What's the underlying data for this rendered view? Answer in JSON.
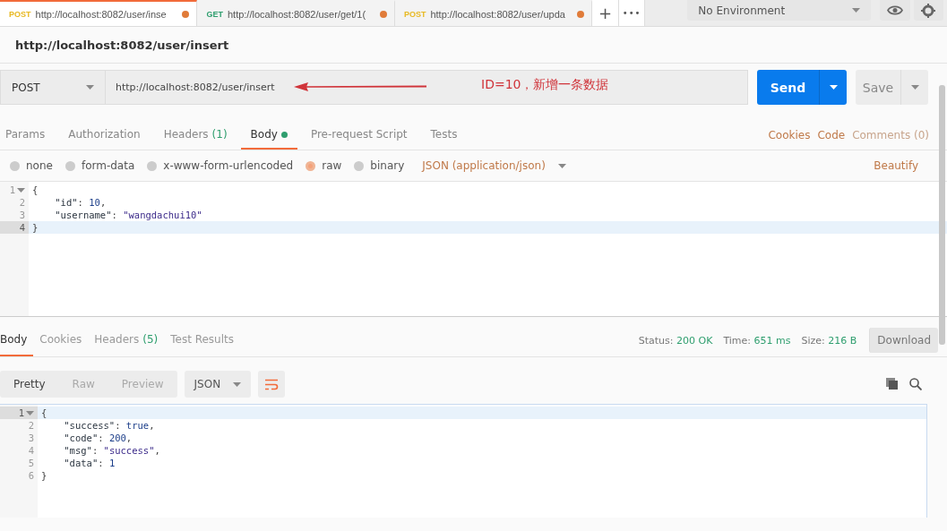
{
  "request_tabs": [
    {
      "method": "POST",
      "color": "#e8b923",
      "url": "http://localhost:8082/user/inse",
      "unsaved": true,
      "selected": true
    },
    {
      "method": "GET",
      "color": "#2e9e6e",
      "url": "http://localhost:8082/user/get/1(",
      "unsaved": true,
      "selected": false
    },
    {
      "method": "POST",
      "color": "#e8b923",
      "url": "http://localhost:8082/user/upda",
      "unsaved": true,
      "selected": false
    }
  ],
  "add_tab": "+",
  "more_tabs": "•••",
  "environment": {
    "value": "No Environment"
  },
  "request_title": "http://localhost:8082/user/insert",
  "request": {
    "method": "POST",
    "url": "http://localhost:8082/user/insert",
    "annotation": "ID=10，新增一条数据",
    "send": "Send",
    "save": "Save"
  },
  "request_sections": [
    {
      "label": "Params",
      "selected": false
    },
    {
      "label": "Authorization",
      "selected": false
    },
    {
      "label": "Headers",
      "count": "(1)",
      "selected": false
    },
    {
      "label": "Body",
      "selected": true,
      "has_content": true
    },
    {
      "label": "Pre-request Script",
      "selected": false
    },
    {
      "label": "Tests",
      "selected": false
    }
  ],
  "request_links": [
    {
      "label": "Cookies",
      "disabled": false
    },
    {
      "label": "Code",
      "disabled": false
    },
    {
      "label": "Comments (0)",
      "disabled": true
    }
  ],
  "body_types": [
    {
      "label": "none",
      "selected": false
    },
    {
      "label": "form-data",
      "selected": false
    },
    {
      "label": "x-www-form-urlencoded",
      "selected": false
    },
    {
      "label": "raw",
      "selected": true
    },
    {
      "label": "binary",
      "selected": false
    }
  ],
  "content_type": "JSON (application/json)",
  "beautify": "Beautify",
  "request_body": [
    {
      "number": "1",
      "foldable": true,
      "highlighted": false,
      "tokens": [
        {
          "text": "{",
          "kind": "punct"
        }
      ]
    },
    {
      "number": "2",
      "foldable": false,
      "highlighted": false,
      "tokens": [
        {
          "text": "    \"id\"",
          "kind": "key"
        },
        {
          "text": ": ",
          "kind": "punct"
        },
        {
          "text": "10",
          "kind": "num"
        },
        {
          "text": ",",
          "kind": "punct"
        }
      ]
    },
    {
      "number": "3",
      "foldable": false,
      "highlighted": false,
      "tokens": [
        {
          "text": "    \"username\"",
          "kind": "key"
        },
        {
          "text": ": ",
          "kind": "punct"
        },
        {
          "text": "\"wangdachui10\"",
          "kind": "str"
        }
      ]
    },
    {
      "number": "4",
      "foldable": false,
      "highlighted": true,
      "tokens": [
        {
          "text": "}",
          "kind": "punct"
        }
      ]
    }
  ],
  "response_tabs": [
    {
      "label": "Body",
      "selected": true
    },
    {
      "label": "Cookies",
      "selected": false
    },
    {
      "label": "Headers",
      "count": "(5)",
      "selected": false
    },
    {
      "label": "Test Results",
      "selected": false
    }
  ],
  "response_stats": [
    {
      "label": "Status:",
      "value": "200 OK"
    },
    {
      "label": "Time:",
      "value": "651 ms"
    },
    {
      "label": "Size:",
      "value": "216 B"
    }
  ],
  "download": "Download",
  "view_modes": [
    {
      "label": "Pretty",
      "selected": true
    },
    {
      "label": "Raw",
      "selected": false
    },
    {
      "label": "Preview",
      "selected": false
    }
  ],
  "response_format": "JSON",
  "response_body": [
    {
      "number": "1",
      "foldable": true,
      "highlighted": true,
      "tokens": [
        {
          "text": "{",
          "kind": "punct"
        }
      ]
    },
    {
      "number": "2",
      "foldable": false,
      "highlighted": false,
      "tokens": [
        {
          "text": "    \"success\"",
          "kind": "key"
        },
        {
          "text": ": ",
          "kind": "punct"
        },
        {
          "text": "true",
          "kind": "bool"
        },
        {
          "text": ",",
          "kind": "punct"
        }
      ]
    },
    {
      "number": "3",
      "foldable": false,
      "highlighted": false,
      "tokens": [
        {
          "text": "    \"code\"",
          "kind": "key"
        },
        {
          "text": ": ",
          "kind": "punct"
        },
        {
          "text": "200",
          "kind": "num"
        },
        {
          "text": ",",
          "kind": "punct"
        }
      ]
    },
    {
      "number": "4",
      "foldable": false,
      "highlighted": false,
      "tokens": [
        {
          "text": "    \"msg\"",
          "kind": "key"
        },
        {
          "text": ": ",
          "kind": "punct"
        },
        {
          "text": "\"success\"",
          "kind": "str"
        },
        {
          "text": ",",
          "kind": "punct"
        }
      ]
    },
    {
      "number": "5",
      "foldable": false,
      "highlighted": false,
      "tokens": [
        {
          "text": "    \"data\"",
          "kind": "key"
        },
        {
          "text": ": ",
          "kind": "punct"
        },
        {
          "text": "1",
          "kind": "num"
        }
      ]
    },
    {
      "number": "6",
      "foldable": false,
      "highlighted": false,
      "tokens": [
        {
          "text": "}",
          "kind": "punct"
        }
      ]
    }
  ]
}
